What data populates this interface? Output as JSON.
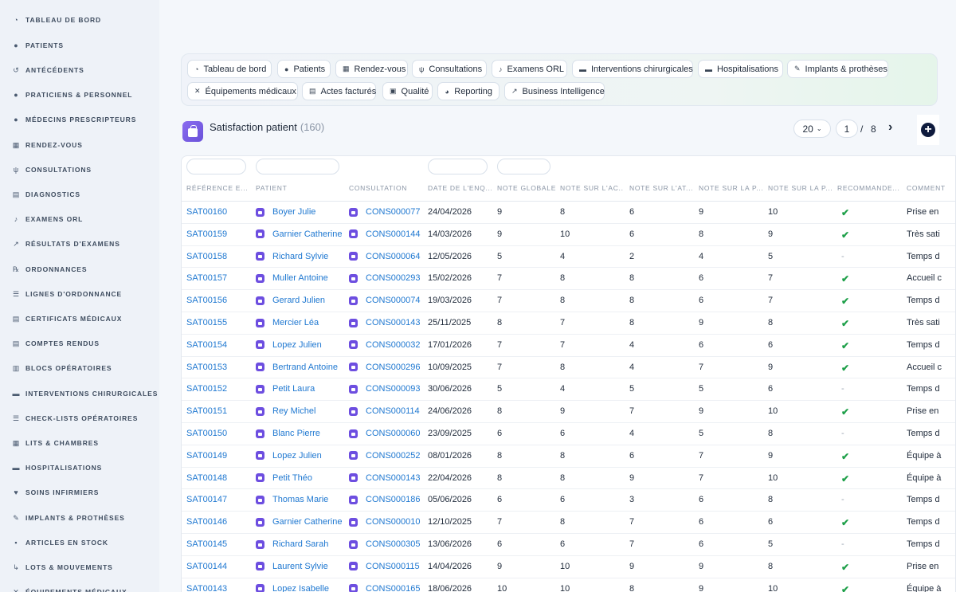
{
  "sidebar": {
    "items": [
      {
        "label": "TABLEAU DE BORD",
        "icon": "dashboard-icon",
        "glyph": "◔"
      },
      {
        "label": "PATIENTS",
        "icon": "user-icon",
        "glyph": "●"
      },
      {
        "label": "ANTÉCÉDENTS",
        "icon": "history-icon",
        "glyph": "↺"
      },
      {
        "label": "PRATICIENS & PERSONNEL",
        "icon": "staff-icon",
        "glyph": "●"
      },
      {
        "label": "MÉDECINS PRESCRIPTEURS",
        "icon": "doctor-icon",
        "glyph": "●"
      },
      {
        "label": "RENDEZ-VOUS",
        "icon": "calendar-icon",
        "glyph": "▦"
      },
      {
        "label": "CONSULTATIONS",
        "icon": "stethoscope-icon",
        "glyph": "ψ"
      },
      {
        "label": "DIAGNOSTICS",
        "icon": "clipboard-icon",
        "glyph": "▤"
      },
      {
        "label": "EXAMENS ORL",
        "icon": "ear-icon",
        "glyph": "♪"
      },
      {
        "label": "RÉSULTATS D'EXAMENS",
        "icon": "chart-line-icon",
        "glyph": "↗"
      },
      {
        "label": "ORDONNANCES",
        "icon": "prescription-icon",
        "glyph": "℞"
      },
      {
        "label": "LIGNES D'ORDONNANCE",
        "icon": "list-icon",
        "glyph": "☰"
      },
      {
        "label": "CERTIFICATS MÉDICAUX",
        "icon": "file-icon",
        "glyph": "▤"
      },
      {
        "label": "COMPTES RENDUS",
        "icon": "file-text-icon",
        "glyph": "▤"
      },
      {
        "label": "BLOCS OPÉRATOIRES",
        "icon": "building-icon",
        "glyph": "▥"
      },
      {
        "label": "INTERVENTIONS CHIRURGICALES",
        "icon": "bed-icon",
        "glyph": "▬"
      },
      {
        "label": "CHECK-LISTS OPÉRATOIRES",
        "icon": "checklist-icon",
        "glyph": "☰"
      },
      {
        "label": "LITS & CHAMBRES",
        "icon": "hospital-icon",
        "glyph": "▦"
      },
      {
        "label": "HOSPITALISATIONS",
        "icon": "bed-icon",
        "glyph": "▬"
      },
      {
        "label": "SOINS INFIRMIERS",
        "icon": "heart-pulse-icon",
        "glyph": "♥"
      },
      {
        "label": "IMPLANTS & PROTHÈSES",
        "icon": "implant-icon",
        "glyph": "✎"
      },
      {
        "label": "ARTICLES EN STOCK",
        "icon": "boxes-icon",
        "glyph": "▪"
      },
      {
        "label": "LOTS & MOUVEMENTS",
        "icon": "dolly-icon",
        "glyph": "↳"
      },
      {
        "label": "ÉQUIPEMENTS MÉDICAUX",
        "icon": "tools-icon",
        "glyph": "✕"
      }
    ]
  },
  "tabs": [
    {
      "label": "Tableau de bord",
      "icon": "dashboard-icon",
      "glyph": "◔"
    },
    {
      "label": "Patients",
      "icon": "user-icon",
      "glyph": "●"
    },
    {
      "label": "Rendez-vous",
      "icon": "calendar-icon",
      "glyph": "▦"
    },
    {
      "label": "Consultations",
      "icon": "stethoscope-icon",
      "glyph": "ψ"
    },
    {
      "label": "Examens ORL",
      "icon": "ear-icon",
      "glyph": "♪"
    },
    {
      "label": "Interventions chirurgicales",
      "icon": "bed-icon",
      "glyph": "▬"
    },
    {
      "label": "Hospitalisations",
      "icon": "bed-icon",
      "glyph": "▬"
    },
    {
      "label": "Implants & prothèses",
      "icon": "implant-icon",
      "glyph": "✎"
    },
    {
      "label": "Équipements médicaux",
      "icon": "tools-icon",
      "glyph": "✕"
    },
    {
      "label": "Actes facturés",
      "icon": "invoice-icon",
      "glyph": "▤"
    },
    {
      "label": "Qualité",
      "icon": "clipboard-check-icon",
      "glyph": "▣"
    },
    {
      "label": "Reporting",
      "icon": "pie-chart-icon",
      "glyph": "◕"
    },
    {
      "label": "Business Intelligence",
      "icon": "chart-line-icon",
      "glyph": "↗"
    }
  ],
  "header": {
    "title": "Satisfaction patient",
    "count": "(160)",
    "page_size": "20",
    "current_page": "1",
    "page_separator": "/",
    "total_pages": "8",
    "next_label": "›",
    "add_label": "+"
  },
  "table": {
    "columns": [
      "RÉFÉRENCE E...",
      "PATIENT",
      "CONSULTATION",
      "DATE DE L'ENQ...",
      "NOTE GLOBALE",
      "NOTE SUR L'AC...",
      "NOTE SUR L'AT...",
      "NOTE SUR LA P...",
      "NOTE SUR LA P...",
      "RECOMMANDE...",
      "COMMENT"
    ],
    "rows": [
      {
        "ref": "SAT00160",
        "patient": "Boyer Julie",
        "consultation": "CONS000077",
        "date": "24/04/2026",
        "n1": "9",
        "n2": "8",
        "n3": "6",
        "n4": "9",
        "n5": "10",
        "recommande": true,
        "comment": "Prise en"
      },
      {
        "ref": "SAT00159",
        "patient": "Garnier Catherine",
        "consultation": "CONS000144",
        "date": "14/03/2026",
        "n1": "9",
        "n2": "10",
        "n3": "6",
        "n4": "8",
        "n5": "9",
        "recommande": true,
        "comment": "Très sati"
      },
      {
        "ref": "SAT00158",
        "patient": "Richard Sylvie",
        "consultation": "CONS000064",
        "date": "12/05/2026",
        "n1": "5",
        "n2": "4",
        "n3": "2",
        "n4": "4",
        "n5": "5",
        "recommande": false,
        "comment": "Temps d"
      },
      {
        "ref": "SAT00157",
        "patient": "Muller Antoine",
        "consultation": "CONS000293",
        "date": "15/02/2026",
        "n1": "7",
        "n2": "8",
        "n3": "8",
        "n4": "6",
        "n5": "7",
        "recommande": true,
        "comment": "Accueil c"
      },
      {
        "ref": "SAT00156",
        "patient": "Gerard Julien",
        "consultation": "CONS000074",
        "date": "19/03/2026",
        "n1": "7",
        "n2": "8",
        "n3": "8",
        "n4": "6",
        "n5": "7",
        "recommande": true,
        "comment": "Temps d"
      },
      {
        "ref": "SAT00155",
        "patient": "Mercier Léa",
        "consultation": "CONS000143",
        "date": "25/11/2025",
        "n1": "8",
        "n2": "7",
        "n3": "8",
        "n4": "9",
        "n5": "8",
        "recommande": true,
        "comment": "Très sati"
      },
      {
        "ref": "SAT00154",
        "patient": "Lopez Julien",
        "consultation": "CONS000032",
        "date": "17/01/2026",
        "n1": "7",
        "n2": "7",
        "n3": "4",
        "n4": "6",
        "n5": "6",
        "recommande": true,
        "comment": "Temps d"
      },
      {
        "ref": "SAT00153",
        "patient": "Bertrand Antoine",
        "consultation": "CONS000296",
        "date": "10/09/2025",
        "n1": "7",
        "n2": "8",
        "n3": "4",
        "n4": "7",
        "n5": "9",
        "recommande": true,
        "comment": "Accueil c"
      },
      {
        "ref": "SAT00152",
        "patient": "Petit Laura",
        "consultation": "CONS000093",
        "date": "30/06/2026",
        "n1": "5",
        "n2": "4",
        "n3": "5",
        "n4": "5",
        "n5": "6",
        "recommande": false,
        "comment": "Temps d"
      },
      {
        "ref": "SAT00151",
        "patient": "Rey Michel",
        "consultation": "CONS000114",
        "date": "24/06/2026",
        "n1": "8",
        "n2": "9",
        "n3": "7",
        "n4": "9",
        "n5": "10",
        "recommande": true,
        "comment": "Prise en"
      },
      {
        "ref": "SAT00150",
        "patient": "Blanc Pierre",
        "consultation": "CONS000060",
        "date": "23/09/2025",
        "n1": "6",
        "n2": "6",
        "n3": "4",
        "n4": "5",
        "n5": "8",
        "recommande": false,
        "comment": "Temps d"
      },
      {
        "ref": "SAT00149",
        "patient": "Lopez Julien",
        "consultation": "CONS000252",
        "date": "08/01/2026",
        "n1": "8",
        "n2": "8",
        "n3": "6",
        "n4": "7",
        "n5": "9",
        "recommande": true,
        "comment": "Équipe à"
      },
      {
        "ref": "SAT00148",
        "patient": "Petit Théo",
        "consultation": "CONS000143",
        "date": "22/04/2026",
        "n1": "8",
        "n2": "8",
        "n3": "9",
        "n4": "7",
        "n5": "10",
        "recommande": true,
        "comment": "Équipe à"
      },
      {
        "ref": "SAT00147",
        "patient": "Thomas Marie",
        "consultation": "CONS000186",
        "date": "05/06/2026",
        "n1": "6",
        "n2": "6",
        "n3": "3",
        "n4": "6",
        "n5": "8",
        "recommande": false,
        "comment": "Temps d"
      },
      {
        "ref": "SAT00146",
        "patient": "Garnier Catherine",
        "consultation": "CONS000010",
        "date": "12/10/2025",
        "n1": "7",
        "n2": "8",
        "n3": "7",
        "n4": "6",
        "n5": "6",
        "recommande": true,
        "comment": "Temps d"
      },
      {
        "ref": "SAT00145",
        "patient": "Richard Sarah",
        "consultation": "CONS000305",
        "date": "13/06/2026",
        "n1": "6",
        "n2": "6",
        "n3": "7",
        "n4": "6",
        "n5": "5",
        "recommande": false,
        "comment": "Temps d"
      },
      {
        "ref": "SAT00144",
        "patient": "Laurent Sylvie",
        "consultation": "CONS000115",
        "date": "14/04/2026",
        "n1": "9",
        "n2": "10",
        "n3": "9",
        "n4": "9",
        "n5": "8",
        "recommande": true,
        "comment": "Prise en"
      },
      {
        "ref": "SAT00143",
        "patient": "Lopez Isabelle",
        "consultation": "CONS000165",
        "date": "18/06/2026",
        "n1": "10",
        "n2": "10",
        "n3": "8",
        "n4": "9",
        "n5": "10",
        "recommande": true,
        "comment": "Équipe à"
      }
    ],
    "check_glyph": "✔",
    "dash_glyph": "-"
  },
  "colors": {
    "link": "#1f78d1",
    "check": "#1fa04a",
    "accent": "#6d4ee0",
    "add_button": "#0f1b3d"
  }
}
